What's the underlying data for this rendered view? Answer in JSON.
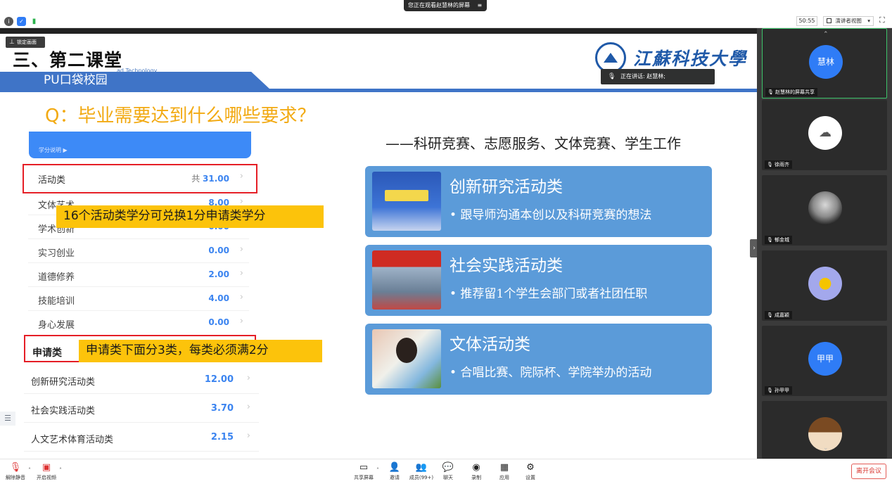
{
  "topbar": {
    "sharing_badge": "您正在观看赵慧林的屏幕",
    "sharing_menu_icon": "≡",
    "timer": "50:55",
    "view_mode": "演讲者视图",
    "view_mode_caret": "▾",
    "fullscreen_icon": "⛶"
  },
  "slide": {
    "lock_badge": "锁定画面",
    "title": "三、第二课堂",
    "subtitle": "PU口袋校园",
    "logo_text": "江蘇科技大學",
    "logo_sub": "ad Technology",
    "speaking": "正在讲话: 赵慧林;",
    "question": "Q：毕业需要达到什么哪些要求？",
    "tagline": "——科研竞赛、志愿服务、文体竞赛、学生工作",
    "credit_header_label": "学分说明 ▶",
    "activity": {
      "label": "活动类",
      "total_prefix": "共",
      "total": "31.00"
    },
    "activity_rows": [
      {
        "label": "文体艺术",
        "value": "8.00"
      },
      {
        "label": "学术创新",
        "value": "0.00"
      },
      {
        "label": "实习创业",
        "value": "0.00"
      },
      {
        "label": "道德修养",
        "value": "2.00"
      },
      {
        "label": "技能培训",
        "value": "4.00"
      },
      {
        "label": "身心发展",
        "value": "0.00"
      }
    ],
    "callout_1": "16个活动类学分可兑换1分申请类学分",
    "apply_label": "申请类",
    "callout_2": "申请类下面分3类，每类必须满2分",
    "apply_rows": [
      {
        "label": "创新研究活动类",
        "value": "12.00"
      },
      {
        "label": "社会实践活动类",
        "value": "3.70"
      },
      {
        "label": "人文艺术体育活动类",
        "value": "2.15"
      }
    ],
    "cards": [
      {
        "title": "创新研究活动类",
        "desc": "• 跟导师沟通本创以及科研竞赛的想法"
      },
      {
        "title": "社会实践活动类",
        "desc": "• 推荐留1个学生会部门或者社团任职"
      },
      {
        "title": "文体活动类",
        "desc": "• 合唱比赛、院际杯、学院举办的活动"
      }
    ],
    "chevron": "›"
  },
  "participants": [
    {
      "avatar": "慧林",
      "name": "赵慧林的屏幕共享",
      "color": "#2f7cf6"
    },
    {
      "avatar": "",
      "name": "徐雨齐",
      "color": "#ffffff"
    },
    {
      "avatar": "",
      "name": "郁金城",
      "color": "#555555"
    },
    {
      "avatar": "",
      "name": "成嘉颖",
      "color": "#9fa5ea"
    },
    {
      "avatar": "甲甲",
      "name": "孙甲甲",
      "color": "#2f7cf6"
    },
    {
      "avatar": "",
      "name": "",
      "color": "#e6d7c3"
    }
  ],
  "toolbar": {
    "unmute": "解除静音",
    "start_video": "开启视频",
    "share_screen": "共享屏幕",
    "invite": "邀请",
    "members": "成员(99+)",
    "chat": "聊天",
    "record": "录制",
    "apps": "应用",
    "settings": "设置",
    "leave": "离开会议"
  }
}
